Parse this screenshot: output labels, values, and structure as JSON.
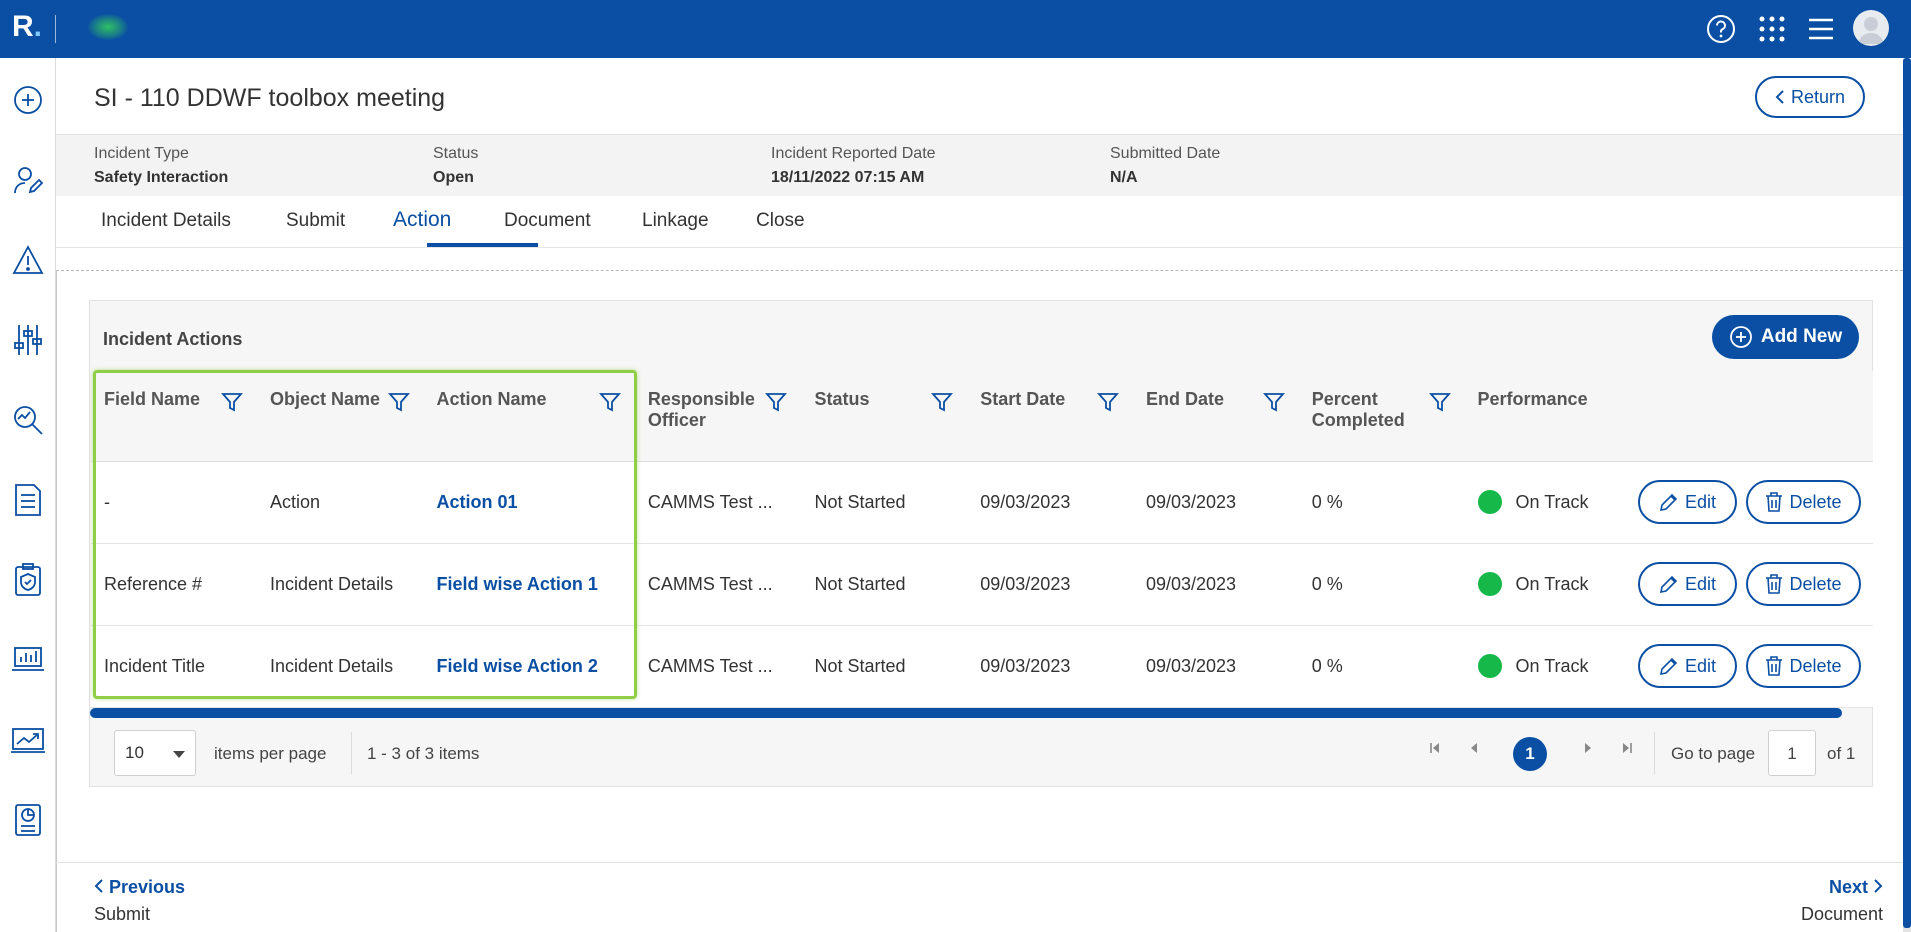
{
  "app": {
    "logo_letter": "R",
    "logo_dot": "."
  },
  "top_icons": [
    "help-icon",
    "apps-grid-icon",
    "menu-icon",
    "avatar"
  ],
  "rail_icons": [
    "add-circle-icon",
    "user-edit-icon",
    "warning-icon",
    "sliders-icon",
    "search-chart-icon",
    "document-icon",
    "shield-doc-icon",
    "laptop-chart-icon",
    "trend-chart-icon",
    "report-icon"
  ],
  "header": {
    "title": "SI - 110 DDWF toolbox meeting",
    "return_label": "Return"
  },
  "meta": {
    "incident_type_label": "Incident Type",
    "incident_type_value": "Safety Interaction",
    "status_label": "Status",
    "status_value": "Open",
    "reported_label": "Incident Reported Date",
    "reported_value": "18/11/2022 07:15 AM",
    "submitted_label": "Submitted Date",
    "submitted_value": "N/A"
  },
  "tabs": [
    {
      "label": "Incident Details"
    },
    {
      "label": "Submit"
    },
    {
      "label": "Action"
    },
    {
      "label": "Document"
    },
    {
      "label": "Linkage"
    },
    {
      "label": "Close"
    }
  ],
  "panel": {
    "title": "Incident Actions",
    "add_new_label": "Add New"
  },
  "table": {
    "headers": {
      "field_name": "Field Name",
      "object_name": "Object Name",
      "action_name": "Action Name",
      "responsible_1": "Responsible",
      "responsible_2": "Officer",
      "status": "Status",
      "start_date": "Start Date",
      "end_date": "End Date",
      "percent_1": "Percent",
      "percent_2": "Completed",
      "performance": "Performance"
    },
    "rows": [
      {
        "field": "-",
        "object": "Action",
        "action": "Action 01",
        "officer": "CAMMS Test ...",
        "status": "Not Started",
        "start": "09/03/2023",
        "end": "09/03/2023",
        "percent": "0 %",
        "performance": "On Track",
        "edit": "Edit",
        "delete": "Delete"
      },
      {
        "field": "Reference #",
        "object": "Incident Details",
        "action": "Field wise Action 1",
        "officer": "CAMMS Test ...",
        "status": "Not Started",
        "start": "09/03/2023",
        "end": "09/03/2023",
        "percent": "0 %",
        "performance": "On Track",
        "edit": "Edit",
        "delete": "Delete"
      },
      {
        "field": "Incident Title",
        "object": "Incident Details",
        "action": "Field wise Action 2",
        "officer": "CAMMS Test ...",
        "status": "Not Started",
        "start": "09/03/2023",
        "end": "09/03/2023",
        "percent": "0 %",
        "performance": "On Track",
        "edit": "Edit",
        "delete": "Delete"
      }
    ]
  },
  "pager": {
    "page_size": "10",
    "items_per_page_label": "items per page",
    "range_text": "1 - 3 of 3 items",
    "current_page": "1",
    "goto_label": "Go to page",
    "goto_value": "1",
    "of_label": "of 1"
  },
  "footer": {
    "prev_label": "Previous",
    "prev_sub": "Submit",
    "next_label": "Next",
    "next_sub": "Document"
  },
  "colors": {
    "brand": "#0a4fa3",
    "on_track": "#16b84a",
    "highlight": "#8fcf47"
  }
}
